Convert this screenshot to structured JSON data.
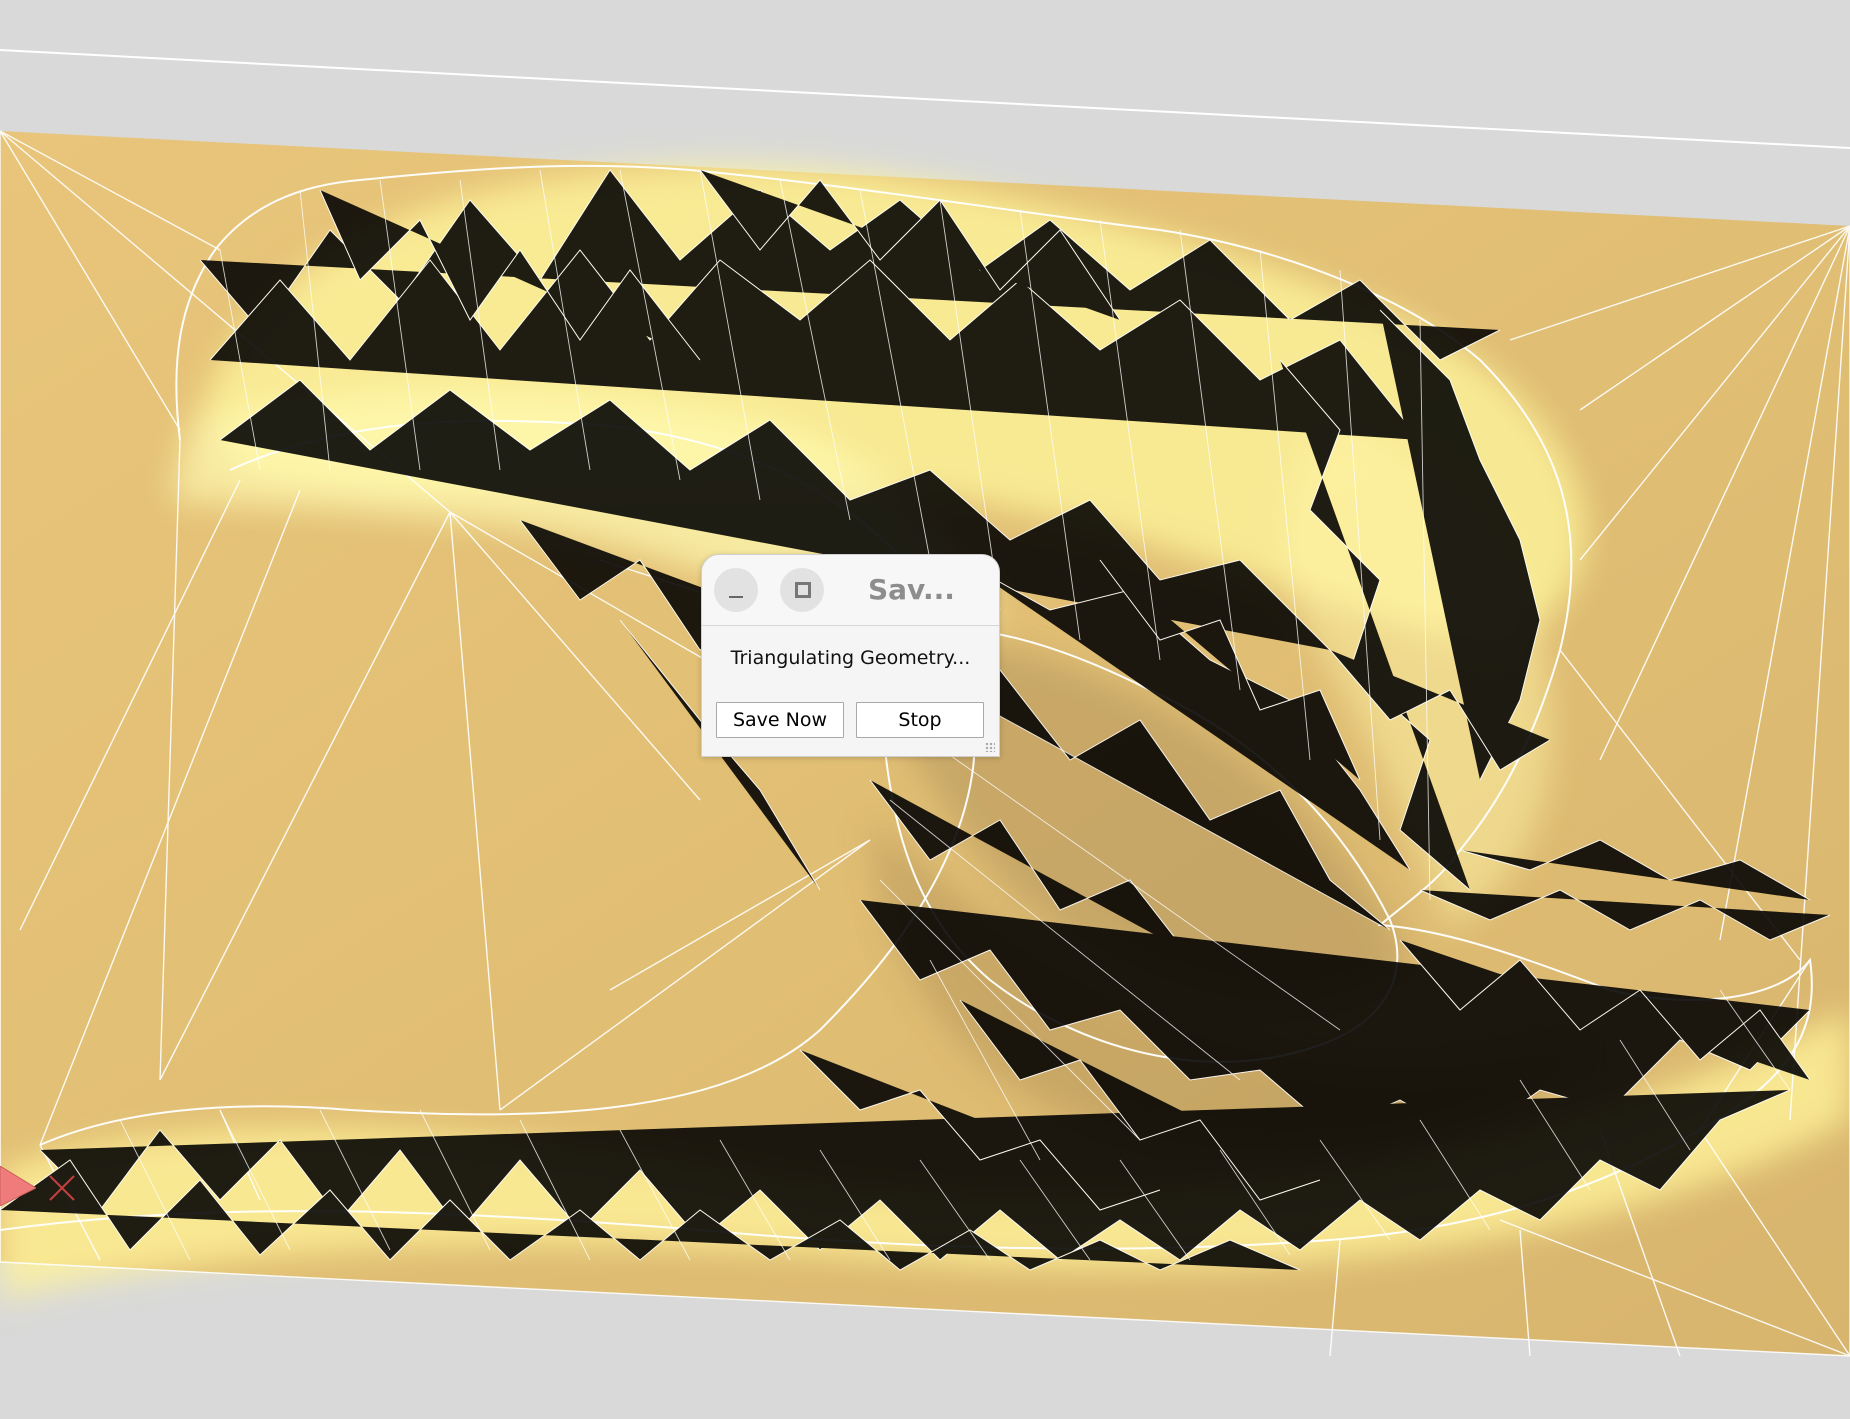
{
  "app": {
    "window_title": "Sav..."
  },
  "dialog": {
    "status": "Triangulating Geometry...",
    "buttons": {
      "save_now": "Save Now",
      "stop": "Stop"
    },
    "controls": {
      "minimize": "minimize",
      "maximize": "maximize"
    }
  },
  "colors": {
    "background": "#d9d9d9",
    "surface_base": "#e4c275",
    "surface_highlight": "#fff8a6",
    "surface_shadow": "#a98b52",
    "mesh_lines": "#ffffff",
    "dialog_background": "#f5f5f5",
    "marker_pink": "#ef7b7b",
    "marker_red": "#c43f3f"
  }
}
